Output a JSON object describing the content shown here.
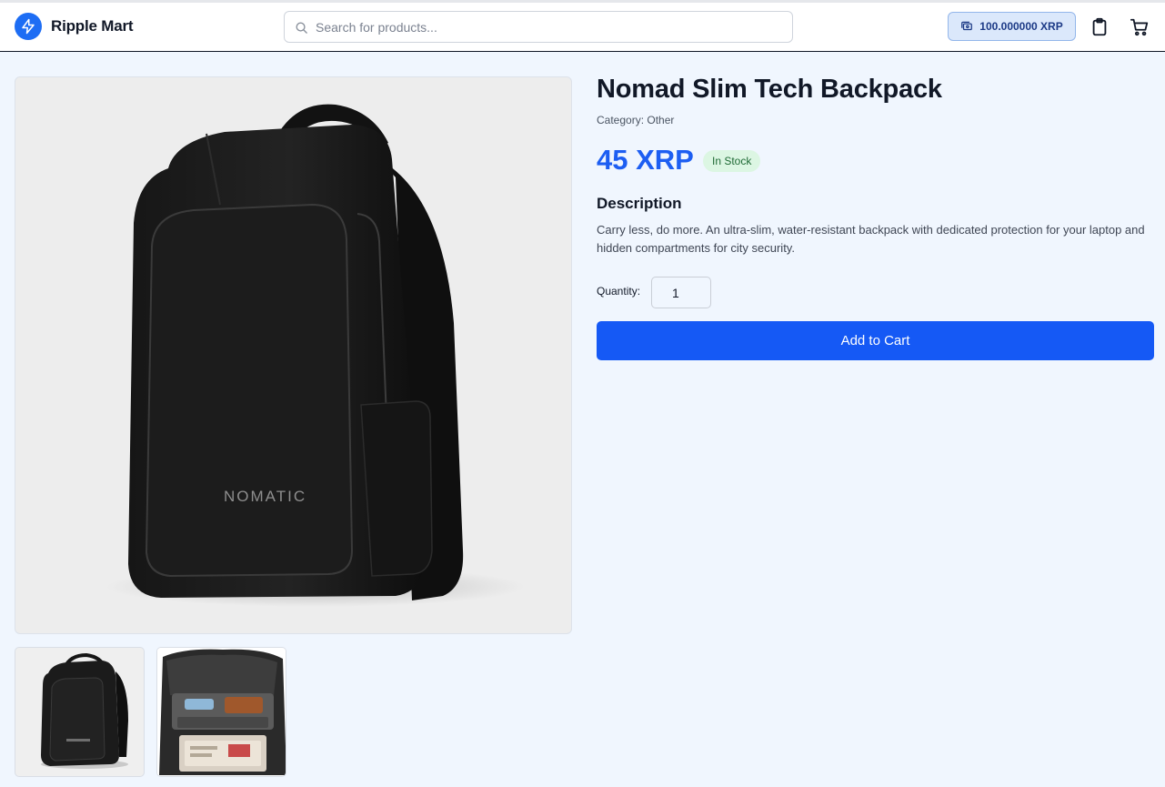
{
  "header": {
    "brand": "Ripple Mart",
    "search_placeholder": "Search for products...",
    "balance": "100.000000 XRP",
    "icons": [
      "bolt-icon",
      "search-icon",
      "wallet-icon",
      "clipboard-icon",
      "cart-icon"
    ]
  },
  "product": {
    "title": "Nomad Slim Tech Backpack",
    "category": "Category: Other",
    "price": "45 XRP",
    "stock_status": "In Stock",
    "description_heading": "Description",
    "description": "Carry less, do more. An ultra-slim, water-resistant backpack with dedicated protection for your laptop and hidden compartments for city security.",
    "quantity_label": "Quantity:",
    "quantity_value": "1",
    "add_to_cart_label": "Add to Cart",
    "brand_mark": "NOMATIC"
  },
  "colors": {
    "accent": "#1559f5",
    "price": "#1d5ef2",
    "stock_bg": "#dcf6e3",
    "stock_text": "#1f6a35",
    "page_bg": "#f0f6fe"
  }
}
